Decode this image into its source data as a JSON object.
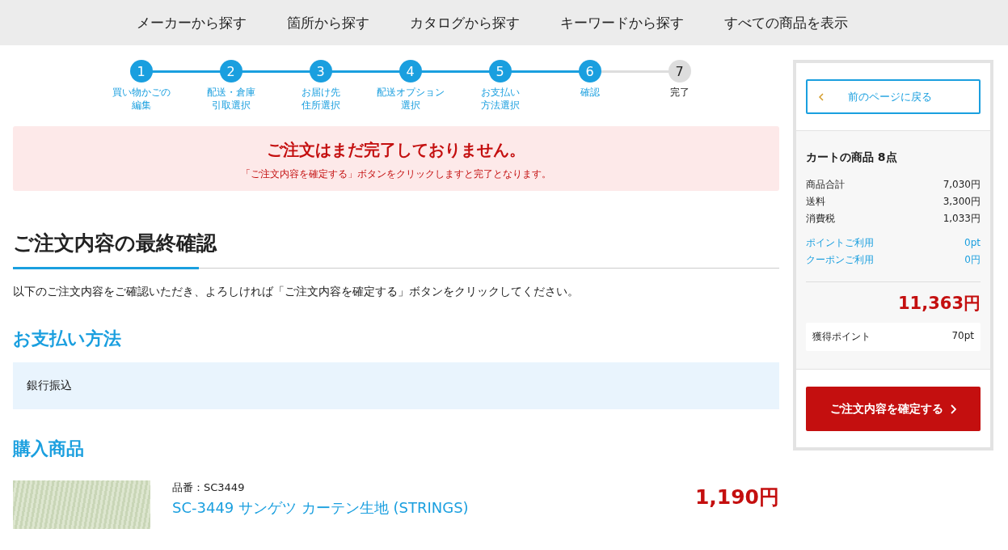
{
  "nav": [
    "メーカーから探す",
    "箇所から探す",
    "カタログから探す",
    "キーワードから探す",
    "すべての商品を表示"
  ],
  "steps": [
    {
      "number": "1",
      "label": [
        "買い物かごの",
        "編集"
      ],
      "done": true
    },
    {
      "number": "2",
      "label": [
        "配送・倉庫",
        "引取選択"
      ],
      "done": true
    },
    {
      "number": "3",
      "label": [
        "お届け先",
        "住所選択"
      ],
      "done": true
    },
    {
      "number": "4",
      "label": [
        "配送オプション",
        "選択"
      ],
      "done": true
    },
    {
      "number": "5",
      "label": [
        "お支払い",
        "方法選択"
      ],
      "done": true
    },
    {
      "number": "6",
      "label": [
        "確認"
      ],
      "done": true
    },
    {
      "number": "7",
      "label": [
        "完了"
      ],
      "done": false
    }
  ],
  "alert": {
    "title": "ご注文はまだ完了しておりません。",
    "message": "「ご注文内容を確定する」ボタンをクリックしますと完了となります。"
  },
  "heading": "ご注文内容の最終確認",
  "intro": "以下のご注文内容をご確認いただき、よろしければ「ご注文内容を確定する」ボタンをクリックしてください。",
  "payment": {
    "heading": "お支払い方法",
    "method": "銀行振込"
  },
  "products": {
    "heading": "購入商品",
    "items": [
      {
        "code": "品番：SC3449",
        "name": "SC-3449 サンゲツ カーテン生地 (STRINGS)",
        "price": "1,190円"
      }
    ]
  },
  "summary": {
    "back": "前のページに戻る",
    "title": "カートの商品 8点",
    "lines": [
      {
        "label": "商品合計",
        "value": "7,030円",
        "kind": "plain"
      },
      {
        "label": "送料",
        "value": "3,300円",
        "kind": "plain"
      },
      {
        "label": "消費税",
        "value": "1,033円",
        "kind": "plain"
      },
      {
        "label": "ポイントご利用",
        "value": "0pt",
        "kind": "discount"
      },
      {
        "label": "クーポンご利用",
        "value": "0円",
        "kind": "discount"
      }
    ],
    "total": "11,363円",
    "points_label": "獲得ポイント",
    "points": "70pt",
    "confirm": "ご注文内容を確定する"
  }
}
